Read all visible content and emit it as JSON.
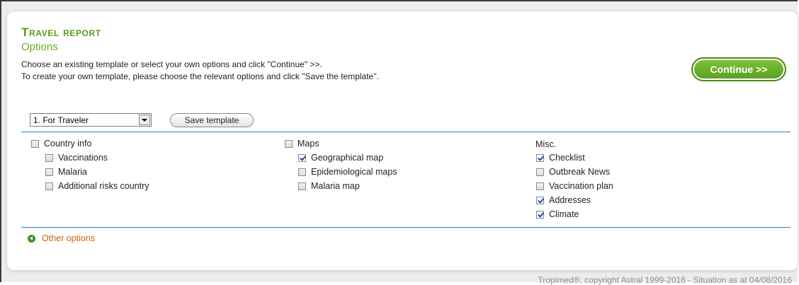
{
  "header": {
    "title": "Travel report",
    "options_heading": "Options",
    "description_line1": "Choose an existing template or select your own options and click \"Continue\" >>.",
    "description_line2": "To create your own template, please choose the relevant options and click \"Save the template\".",
    "continue_label": "Continue >>"
  },
  "template": {
    "selected": "1. For Traveler",
    "save_label": "Save template"
  },
  "groups": {
    "country": {
      "label": "Country info",
      "checked": false,
      "items": [
        {
          "label": "Vaccinations",
          "checked": false
        },
        {
          "label": "Malaria",
          "checked": false
        },
        {
          "label": "Additional risks country",
          "checked": false
        }
      ]
    },
    "maps": {
      "label": "Maps",
      "checked": false,
      "items": [
        {
          "label": "Geographical map",
          "checked": true
        },
        {
          "label": "Epidemiological maps",
          "checked": false
        },
        {
          "label": "Malaria map",
          "checked": false
        }
      ]
    },
    "misc": {
      "label": "Misc.",
      "items": [
        {
          "label": "Checklist",
          "checked": true
        },
        {
          "label": "Outbreak News",
          "checked": false
        },
        {
          "label": "Vaccination plan",
          "checked": false
        },
        {
          "label": "Addresses",
          "checked": true
        },
        {
          "label": "Climate",
          "checked": true
        }
      ]
    }
  },
  "other_options_label": "Other options",
  "footer": "Tropimed®, copyright Astral 1999-2016 - Situation as at 04/08/2016",
  "colors": {
    "accent_green": "#5a9a1a",
    "divider_blue": "#2a7fc0",
    "link_orange": "#c66a10"
  }
}
